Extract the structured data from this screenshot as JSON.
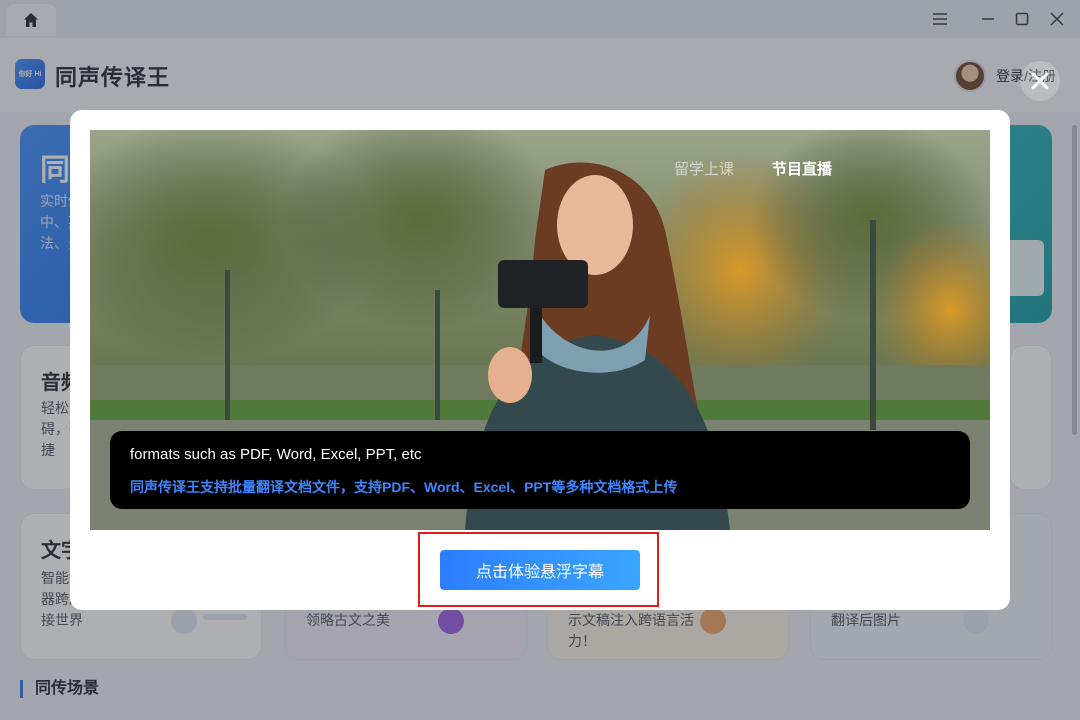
{
  "app": {
    "title": "同声传译王",
    "login_label": "登录/注册",
    "logo_text": "你好 Hi"
  },
  "cards": [
    {
      "title": "同声",
      "desc": "实时传译中、英法、多译"
    },
    {
      "title": "音频",
      "desc": "轻松无障碍，确快捷"
    },
    {
      "title": "文字",
      "desc": "智能翻译器跨越连接世界"
    },
    {
      "title": "",
      "desc": "领略古文之美"
    },
    {
      "title": "",
      "desc": "示文稿注入跨语言活力！"
    },
    {
      "title": "",
      "desc": "翻译后图片"
    }
  ],
  "section": {
    "title": "同传场景"
  },
  "modal": {
    "tabs": [
      {
        "label": "留学上课",
        "active": false
      },
      {
        "label": "节目直播",
        "active": true
      }
    ],
    "subtitle_en": "formats such as PDF, Word, Excel, PPT, etc",
    "subtitle_zh": "同声传译王支持批量翻译文档文件，支持PDF、Word、Excel、PPT等多种文档格式上传",
    "cta_label": "点击体验悬浮字幕"
  },
  "colors": {
    "accent": "#2d7dff",
    "subtitle_zh": "#3d86ff",
    "highlight_frame": "#e21b1b"
  }
}
